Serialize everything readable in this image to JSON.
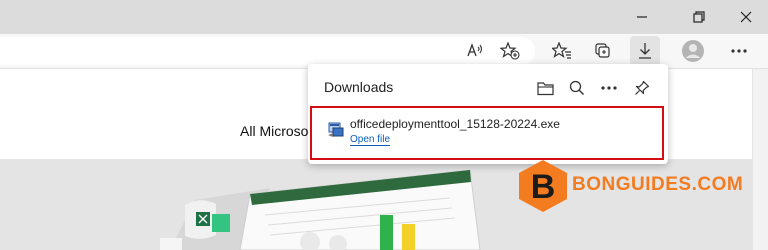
{
  "window": {
    "minimize_icon": "minimize-icon",
    "restore_icon": "restore-icon",
    "close_icon": "close-icon"
  },
  "toolbar": {
    "icons": [
      "read-aloud-icon",
      "add-favorite-icon",
      "favorites-icon",
      "collections-icon",
      "downloads-icon",
      "profile-avatar",
      "more-icon"
    ]
  },
  "page": {
    "nav_text": "All Microso"
  },
  "downloads": {
    "title": "Downloads",
    "icons": [
      "open-folder-icon",
      "search-icon",
      "more-options-icon",
      "pin-icon"
    ],
    "items": [
      {
        "filename": "officedeploymenttool_15128-20224.exe",
        "action": "Open file"
      }
    ],
    "highlight_color": "#d40d12"
  },
  "watermark": {
    "letter": "B",
    "text": "BONGUIDES.COM",
    "color": "#f47c20"
  }
}
